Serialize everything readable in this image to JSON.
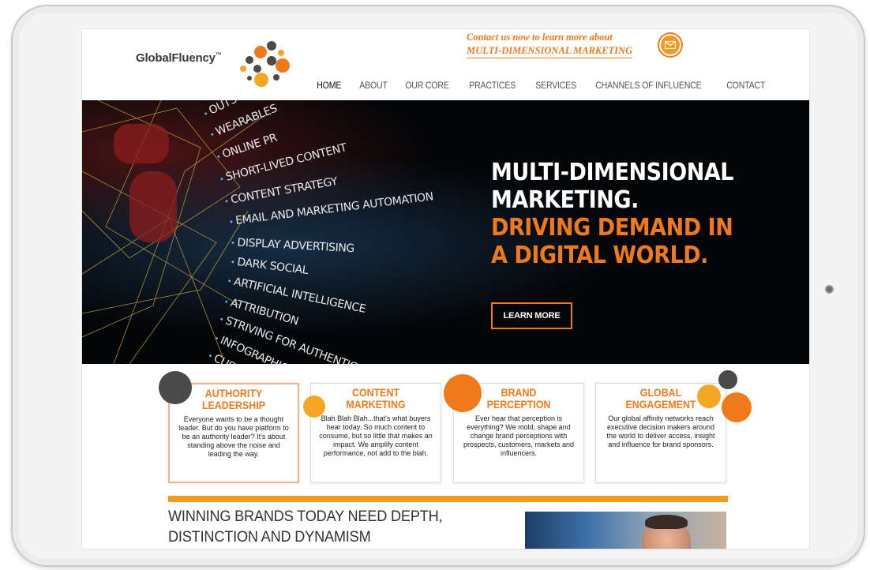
{
  "brand": {
    "name": "GlobalFluency",
    "trademark": "™",
    "accent": "#f07a1a",
    "dark_dot": "#4a4a4a",
    "light_orange": "#f5a623"
  },
  "header": {
    "cta_line1": "Contact us now to learn more about",
    "cta_line2": "MULTI-DIMENSIONAL MARKETING",
    "cta_icon": "envelope-icon"
  },
  "nav": {
    "items": [
      {
        "label": "HOME",
        "active": true
      },
      {
        "label": "ABOUT",
        "active": false
      },
      {
        "label": "OUR CORE",
        "active": false
      },
      {
        "label": "PRACTICES",
        "active": false
      },
      {
        "label": "SERVICES",
        "active": false
      },
      {
        "label": "CHANNELS OF INFLUENCE",
        "active": false
      },
      {
        "label": "CONTACT",
        "active": false
      }
    ]
  },
  "hero": {
    "words": [
      "OUTSOURCING",
      "WEARABLES",
      "ONLINE PR",
      "SHORT-LIVED CONTENT",
      "CONTENT STRATEGY",
      "EMAIL AND MARKETING AUTOMATION",
      "DISPLAY ADVERTISING",
      "DARK SOCIAL",
      "ARTIFICIAL INTELLIGENCE",
      "ATTRIBUTION",
      "STRIVING FOR AUTHENTICITY",
      "INFOGRAPHICS",
      "CUSTOM"
    ],
    "headline_white_1": "MULTI-DIMENSIONAL",
    "headline_white_2": "MARKETING.",
    "headline_orange_1": "DRIVING DEMAND IN",
    "headline_orange_2": "A DIGITAL WORLD.",
    "button_label": "LEARN MORE"
  },
  "cards": [
    {
      "title": "AUTHORITY\nLEADERSHIP",
      "body": "Everyone wants to be a thought leader. But do you have platform to be an authority leader? It's about standing above the noise and leading the way."
    },
    {
      "title": "CONTENT\nMARKETING",
      "body": "Blah Blah Blah...that's what buyers hear today. So much content to consume, but so little that makes an impact. We amplify content performance, not add to the blah."
    },
    {
      "title": "BRAND\nPERCEPTION",
      "body": "Ever hear that perception is everything? We mold, shape and change brand perceptions with prospects, customers, markets and influencers."
    },
    {
      "title": "GLOBAL\nENGAGEMENT",
      "body": "Our global affinity networks reach executive decision makers around the world to deliver access, insight and influence for brand sponsors."
    }
  ],
  "bottom": {
    "tagline": "WINNING BRANDS TODAY NEED DEPTH,\nDISTINCTION AND DYNAMISM"
  }
}
